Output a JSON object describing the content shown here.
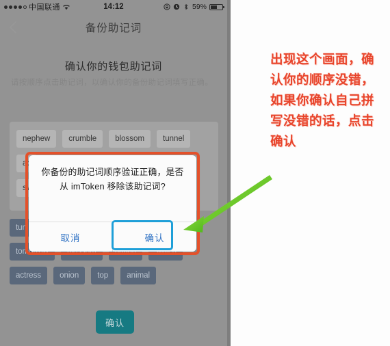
{
  "phone": {
    "statusbar": {
      "carrier": "中国联通",
      "signal_dots_filled": 4,
      "signal_dots_total": 5,
      "wifi_icon": "wifi-icon",
      "time": "14:12",
      "rotation_lock_icon": "rotation-lock-icon",
      "alarm_icon": "alarm-clock-icon",
      "bluetooth_icon": "bluetooth-icon",
      "battery_percent": "59%",
      "battery_level": 59
    },
    "navbar": {
      "back_icon": "chevron-left-icon",
      "title": "备份助记词"
    },
    "content": {
      "heading": "确认你的钱包助记词",
      "subtitle": "请按顺序点击助记词，以确认你的备份助记词填写正确。",
      "selected_rows": [
        [
          "nephew",
          "crumble",
          "blossom",
          "tunnel"
        ],
        [
          "ac",
          "sw"
        ]
      ],
      "bank_rows": [
        [
          "tun"
        ],
        [
          "tomorrow",
          "blossom",
          "nation",
          "switch"
        ],
        [
          "actress",
          "onion",
          "top",
          "animal"
        ]
      ],
      "bottom_button": "确认"
    },
    "dialog": {
      "message": "你备份的助记词顺序验证正确，是否从 imToken 移除该助记词?",
      "cancel_label": "取消",
      "confirm_label": "确认"
    }
  },
  "annotation": {
    "text": "出现这个画面，确认你的顺序没错，如果你确认自己拼写没错的话，点击确认"
  },
  "colors": {
    "red_box": "#e4512a",
    "blue_highlight": "#1e9fd8",
    "green_arrow": "#6ec82a",
    "annotation_red": "#e8452c",
    "teal_button": "#177f88",
    "chip_dark": "#5e6d80",
    "chip_light": "#bdbdbd"
  }
}
